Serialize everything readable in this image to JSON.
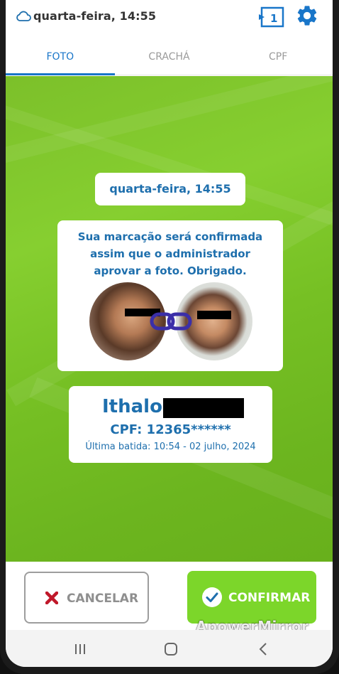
{
  "header": {
    "datetime": "quarta-feira, 14:55",
    "cloud_icon": "cloud-icon",
    "queue_icon": "queue-counter-icon",
    "queue_count": "1",
    "settings_icon": "gear-icon"
  },
  "tabs": [
    {
      "label": "FOTO",
      "active": true
    },
    {
      "label": "CRACHÁ",
      "active": false
    },
    {
      "label": "CPF",
      "active": false
    }
  ],
  "main": {
    "datetime_card": "quarta-feira, 14:55",
    "message": "Sua marcação será confirmada assim que o administrador aprovar a foto. Obrigado.",
    "link_icon": "link-icon",
    "user": {
      "first_name": "Ithalo",
      "cpf": "CPF: 12365******",
      "last_punch": "Última batida: 10:54 - 02 julho, 2024"
    }
  },
  "actions": {
    "cancel_label": "CANCELAR",
    "confirm_label": "CONFIRMAR"
  },
  "watermark": "ApowerMirror",
  "colors": {
    "accent_blue": "#1976c9",
    "text_blue": "#1e6fad",
    "background_green": "#7cc02a",
    "confirm_green": "#7cd62a",
    "cancel_red": "#c0182a"
  }
}
